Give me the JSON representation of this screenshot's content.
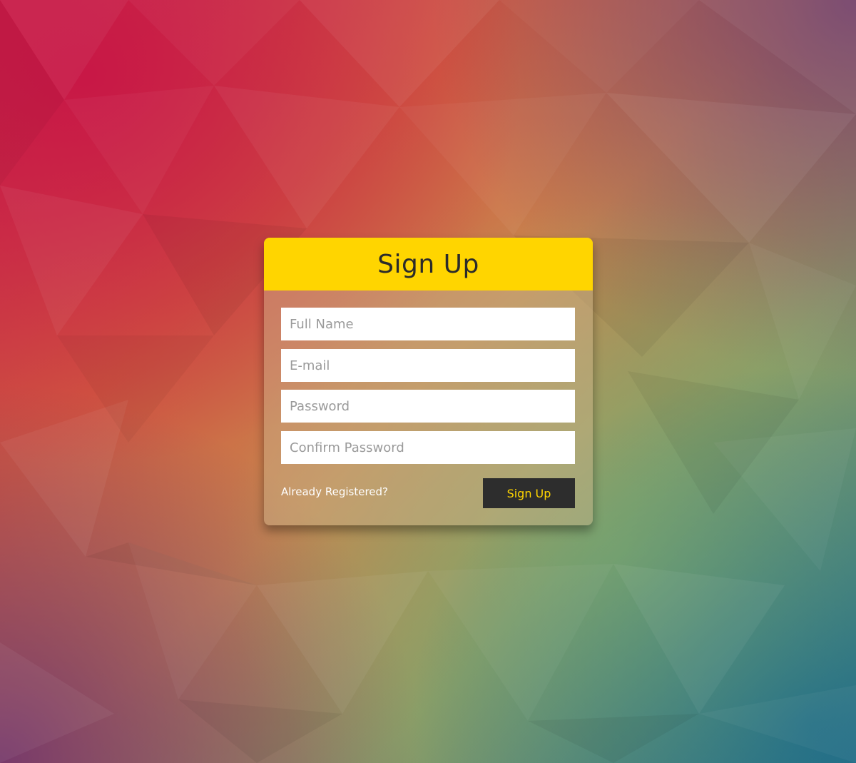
{
  "form": {
    "title": "Sign Up",
    "fields": [
      {
        "placeholder": "Full Name",
        "value": ""
      },
      {
        "placeholder": "E-mail",
        "value": ""
      },
      {
        "placeholder": "Password",
        "value": ""
      },
      {
        "placeholder": "Confirm Password",
        "value": ""
      }
    ],
    "already_registered_label": "Already Registered?",
    "submit_label": "Sign Up"
  },
  "colors": {
    "accent": "#ffd500",
    "button_bg": "#2d2d2d",
    "title_text": "#2b2b2b"
  }
}
